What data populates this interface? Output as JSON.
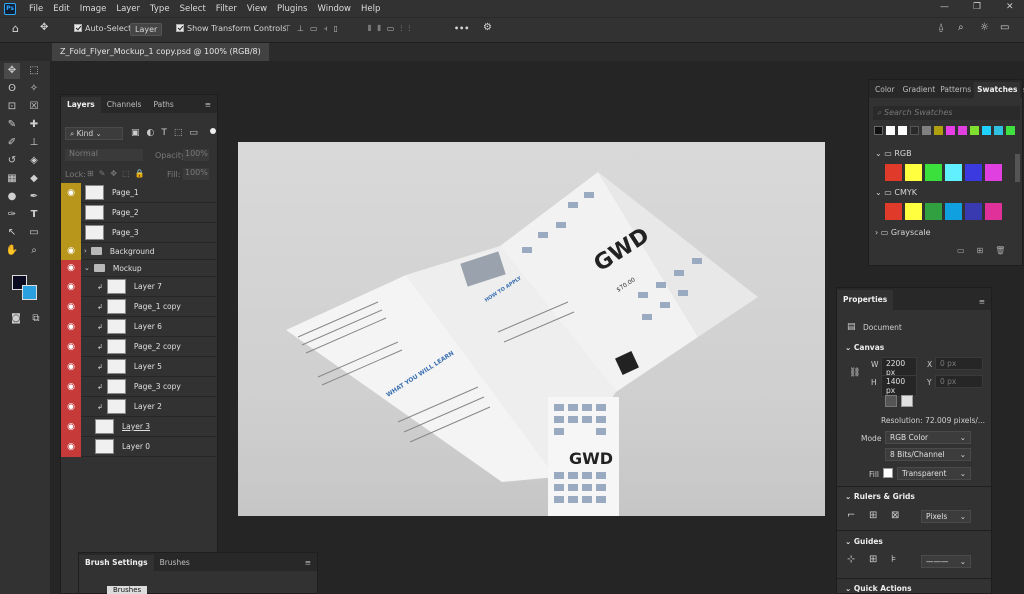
{
  "menu": [
    "File",
    "Edit",
    "Image",
    "Layer",
    "Type",
    "Select",
    "Filter",
    "View",
    "Plugins",
    "Window",
    "Help"
  ],
  "options": {
    "auto_select": "Auto-Select:",
    "layer": "Layer",
    "transform": "Show Transform Controls",
    "more": "•••"
  },
  "doc_tab": "Z_Fold_Flyer_Mockup_1 copy.psd @ 100% (RGB/8)",
  "layers_panel": {
    "tabs": [
      "Layers",
      "Channels",
      "Paths"
    ],
    "kind": "Kind",
    "blend": "Normal",
    "opacity_label": "Opacity:",
    "opacity": "100%",
    "lock_label": "Lock:",
    "fill_label": "Fill:",
    "fill": "100%",
    "rows": [
      "Page_1",
      "Page_2",
      "Page_3",
      "Background",
      "Mockup",
      "Layer 7",
      "Page_1 copy",
      "Layer 6",
      "Page_2 copy",
      "Layer 5",
      "Page_3 copy",
      "Layer 2",
      "Layer 3",
      "Layer 0"
    ]
  },
  "swatches_panel": {
    "tabs": [
      "Color",
      "Gradient",
      "Patterns",
      "Swatches"
    ],
    "search": "Search Swatches",
    "groups": [
      "RGB",
      "CMYK",
      "Grayscale"
    ],
    "recent": [
      "#111111",
      "#ffffff",
      "#ffffff",
      "#2a2a2a",
      "#808080",
      "#b0a010",
      "#e83ee8",
      "#e040e0",
      "#80e030",
      "#20d0ff",
      "#30c0e0",
      "#40e040"
    ],
    "rgb": [
      "#e03a2a",
      "#ffff40",
      "#3ce03c",
      "#60f0ff",
      "#3a3ae0",
      "#e040e0"
    ],
    "cmyk": [
      "#e03a2a",
      "#ffff40",
      "#30a040",
      "#10a0e0",
      "#3a3ab0",
      "#e0309a"
    ]
  },
  "properties": {
    "title": "Properties",
    "document": "Document",
    "canvas": "Canvas",
    "w_label": "W",
    "w": "2200 px",
    "x_label": "X",
    "x": "0 px",
    "h_label": "H",
    "h": "1400 px",
    "y_label": "Y",
    "y": "0 px",
    "resolution": "Resolution: 72.009 pixels/...",
    "mode_label": "Mode",
    "mode": "RGB Color",
    "bits": "8 Bits/Channel",
    "fill_label": "Fill",
    "fill": "Transparent",
    "rulers": "Rulers & Grids",
    "units": "Pixels",
    "guides": "Guides",
    "quick": "Quick Actions"
  },
  "brush_panel": {
    "tabs": [
      "Brush Settings",
      "Brushes"
    ],
    "btn": "Brushes"
  },
  "flyer": {
    "brand": "GWD",
    "price": "$70.00",
    "heading_learn": "WHAT YOU WILL LEARN",
    "heading_apply": "HOW TO APPLY"
  }
}
